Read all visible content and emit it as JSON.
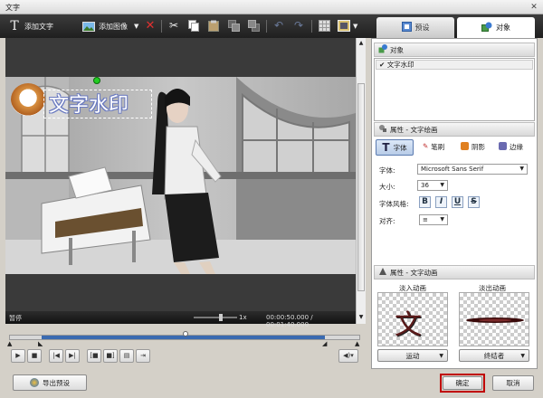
{
  "window": {
    "title": "文字",
    "close": "✕"
  },
  "toolbar": {
    "add_text": "添加文字",
    "add_image": "添加图像"
  },
  "tabs": {
    "preset": "预设",
    "object": "对象"
  },
  "preview": {
    "watermark_text": "文字水印",
    "status": "暂停",
    "speed": "1x",
    "time": "00:00:50.000 / 00:01:40.000"
  },
  "objects": {
    "header": "对象",
    "items": [
      "文字水印"
    ]
  },
  "text_props": {
    "header": "属性 - 文字绘画",
    "tabs": [
      "字体",
      "笔刷",
      "阴影",
      "边缘"
    ],
    "font_label": "字体:",
    "font_value": "Microsoft Sans Serif",
    "size_label": "大小:",
    "size_value": "36",
    "style_label": "字体风格:",
    "style_buttons": [
      "B",
      "I",
      "U",
      "S"
    ],
    "align_label": "对齐:",
    "align_value": "≡"
  },
  "anim_props": {
    "header": "属性 - 文字动画",
    "fade_in_label": "淡入动画",
    "fade_out_label": "淡出动画",
    "fade_in_select": "运动",
    "fade_out_select": "终结者",
    "fade_in_glyph": "文"
  },
  "footer": {
    "export_preset": "导出预设",
    "ok": "确定",
    "cancel": "取消"
  },
  "colors": {
    "accent_red": "#c00000",
    "toolbar_bg": "#2a2a2a",
    "timeline": "#3a6ab0"
  }
}
